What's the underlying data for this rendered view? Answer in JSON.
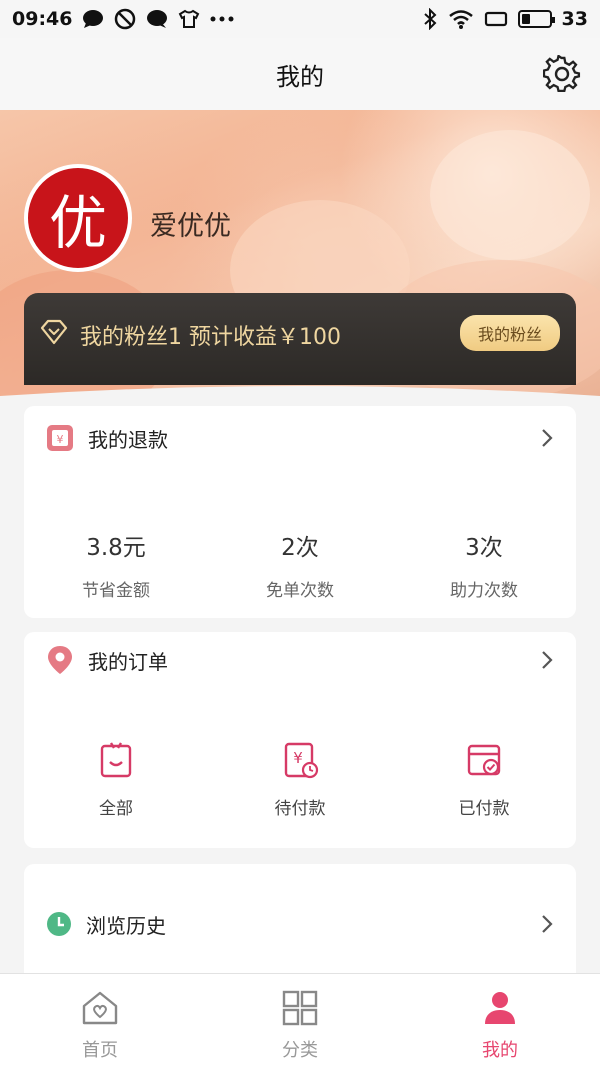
{
  "status_bar": {
    "time": "09:46",
    "battery": "33",
    "battery_level": 0.33
  },
  "header": {
    "title": "我的"
  },
  "profile": {
    "avatar_char": "优",
    "username": "爱优优"
  },
  "fans": {
    "text": "我的粉丝1 预计收益￥100",
    "button": "我的粉丝"
  },
  "refund": {
    "title": "我的退款",
    "stats": [
      {
        "value": "3.8元",
        "label": "节省金额"
      },
      {
        "value": "2次",
        "label": "免单次数"
      },
      {
        "value": "3次",
        "label": "助力次数"
      }
    ]
  },
  "orders": {
    "title": "我的订单",
    "items": [
      {
        "label": "全部"
      },
      {
        "label": "待付款"
      },
      {
        "label": "已付款"
      }
    ]
  },
  "history": {
    "title": "浏览历史"
  },
  "tabbar": {
    "items": [
      {
        "label": "首页"
      },
      {
        "label": "分类"
      },
      {
        "label": "我的"
      }
    ]
  },
  "colors": {
    "accent": "#e7466f",
    "fans_text": "#efd6a0",
    "avatar_bg": "#c8141a"
  }
}
